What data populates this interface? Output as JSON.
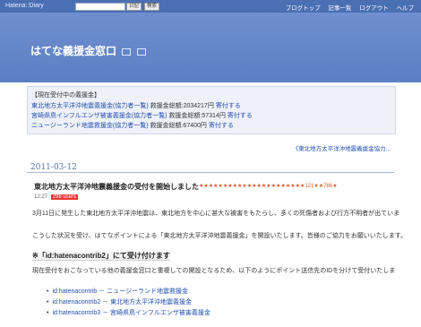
{
  "topbar": {
    "brand": "Hatena::Diary",
    "search_placeholder": "",
    "btn_diary": "日記",
    "btn_search": "検索",
    "nav": [
      "ブログトップ",
      "記事一覧",
      "ログアウト",
      "ヘルプ"
    ]
  },
  "header": {
    "title": "はてな義援金窓口"
  },
  "notice": {
    "head": "【現在受付中の義援金】",
    "rows": [
      {
        "name": "東北地方太平洋沖地震義援金(協力者一覧)",
        "amount": "救援金総額:2034217円",
        "action": "寄付する"
      },
      {
        "name": "宮崎県鳥インフルエンザ被害義援金(協力者一覧)",
        "amount": "救援金総額:57314円",
        "action": "寄付する"
      },
      {
        "name": "ニュージーランド地震救援金(協力者一覧)",
        "amount": "救援金総額:67400円",
        "action": "寄付する"
      }
    ]
  },
  "prev_link": "《東北地方太平洋沖地震義援金協力...",
  "entry": {
    "date": "2011-03-12",
    "title": "東北地方太平洋沖地震義援金の受付を開始しました",
    "stars": "★★★★★★★★★★★★★★★★★★★★★★121★★766★",
    "time": "12:27",
    "users": "298 users",
    "p1": "3月11日に発生した東北地方太平洋沖地震は、東北地方を中心に甚大な被害をもたらし、多くの死傷者および行方不明者が出ていま",
    "p2": "こうした状況を受け、はてなポイントによる「東北地方太平洋沖地震義援金」を開設いたします。皆様のご協力をお願いいたします。",
    "h4": "※「id:hatenacontrib2」にて受け付けます",
    "p3": "現在受付をおこなっている他の義援金窓口と重複しての開設となるため、以下のようにポイント送信先のIDを分けて受付いたしま",
    "list": [
      "id:hatenacontrib － ニュージーランド地震救援金",
      "id:hatenacontrib2 － 東北地方太平洋沖地震義援金",
      "id:hatenacontrib3 － 宮崎県鳥インフルエンザ被害義援金"
    ]
  }
}
